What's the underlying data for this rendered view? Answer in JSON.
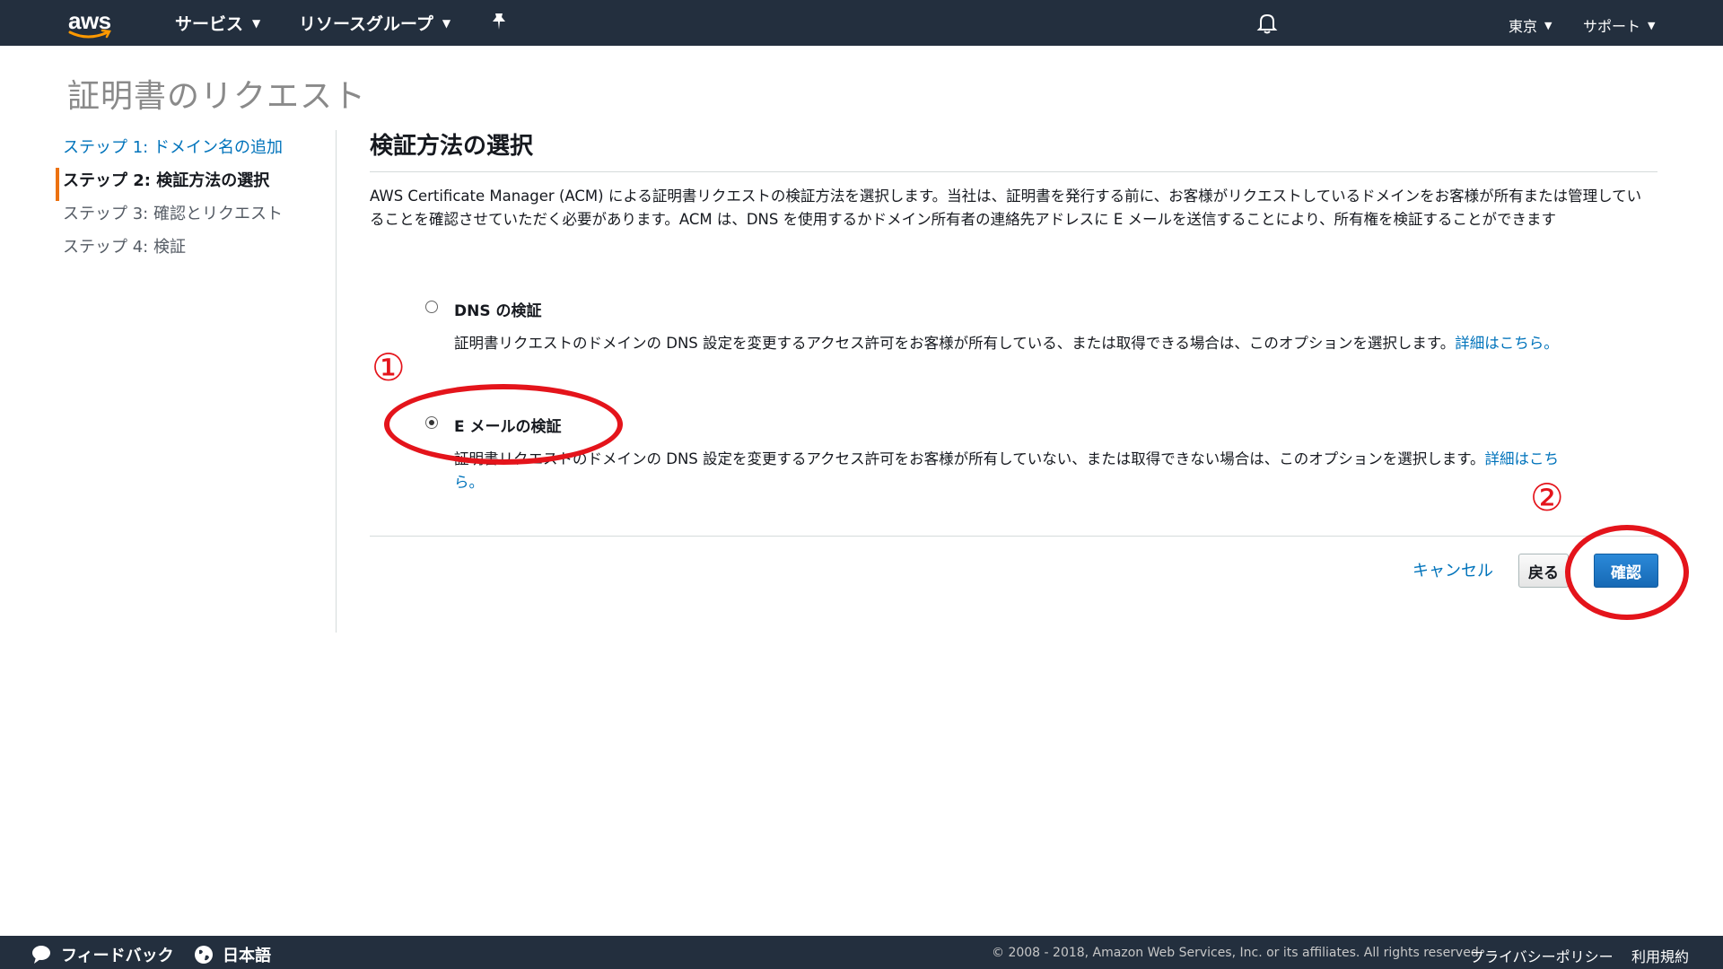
{
  "nav": {
    "logo_text": "aws",
    "services": "サービス",
    "resource_groups": "リソースグループ",
    "region": "東京",
    "support": "サポート"
  },
  "page_title": "証明書のリクエスト",
  "steps": [
    {
      "label": "ステップ 1: ドメイン名の追加"
    },
    {
      "label": "ステップ 2: 検証方法の選択"
    },
    {
      "label": "ステップ 3: 確認とリクエスト"
    },
    {
      "label": "ステップ 4: 検証"
    }
  ],
  "main": {
    "title": "検証方法の選択",
    "description": "AWS Certificate Manager (ACM) による証明書リクエストの検証方法を選択します。当社は、証明書を発行する前に、お客様がリクエストしているドメインをお客様が所有または管理していることを確認させていただく必要があります。ACM は、DNS を使用するかドメイン所有者の連絡先アドレスに E メールを送信することにより、所有権を検証することができます",
    "options": [
      {
        "label": "DNS の検証",
        "description": "証明書リクエストのドメインの DNS 設定を変更するアクセス許可をお客様が所有している、または取得できる場合は、このオプションを選択します。",
        "more": "詳細はこちら。"
      },
      {
        "label": "E メールの検証",
        "description": "証明書リクエストのドメインの DNS 設定を変更するアクセス許可をお客様が所有していない、または取得できない場合は、このオプションを選択します。",
        "more": "詳細はこちら。"
      }
    ]
  },
  "actions": {
    "cancel": "キャンセル",
    "back": "戻る",
    "confirm": "確認"
  },
  "annotations": {
    "one": "①",
    "two": "②",
    "color": "#e4141b"
  },
  "footer": {
    "feedback": "フィードバック",
    "language": "日本語",
    "copyright": "© 2008 - 2018, Amazon Web Services, Inc. or its affiliates. All rights reserved.",
    "privacy": "プライバシーポリシー",
    "terms": "利用規約"
  },
  "colors": {
    "nav_bg": "#232f3e",
    "link": "#0073bb",
    "active_step": "#ec7211",
    "primary_button": "#1669b5"
  }
}
